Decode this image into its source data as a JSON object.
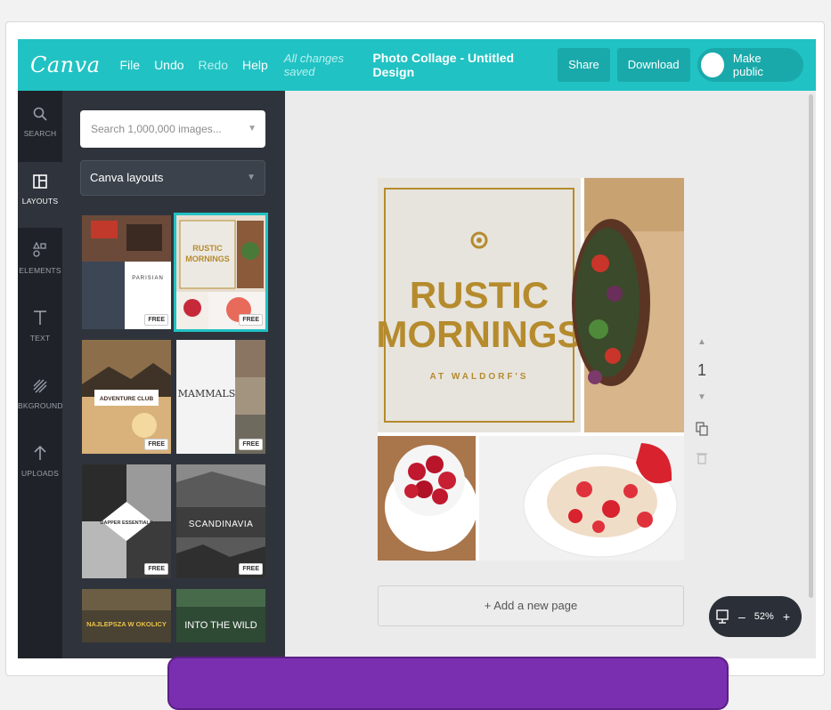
{
  "topbar": {
    "logo": "Canva",
    "menu": {
      "file": "File",
      "undo": "Undo",
      "redo": "Redo",
      "help": "Help"
    },
    "status": "All changes saved",
    "doc_title": "Photo Collage - Untitled Design",
    "share": "Share",
    "download": "Download",
    "make_public": "Make public"
  },
  "rail": [
    {
      "label": "SEARCH",
      "icon": "search-icon"
    },
    {
      "label": "LAYOUTS",
      "icon": "layouts-icon"
    },
    {
      "label": "ELEMENTS",
      "icon": "elements-icon"
    },
    {
      "label": "TEXT",
      "icon": "text-icon"
    },
    {
      "label": "BKGROUND",
      "icon": "background-icon"
    },
    {
      "label": "UPLOADS",
      "icon": "upload-icon"
    }
  ],
  "panel": {
    "search_placeholder": "Search 1,000,000 images...",
    "select_value": "Canva layouts",
    "badge": "FREE",
    "layouts": [
      {
        "lines": [
          "PARISIAN"
        ]
      },
      {
        "lines": [
          "RUSTIC",
          "MORNINGS"
        ]
      },
      {
        "lines": [
          "ADVENTURE CLUB"
        ]
      },
      {
        "lines": [
          "MAMMALS"
        ]
      },
      {
        "lines": [
          "DAPPER ESSENTIALS"
        ]
      },
      {
        "lines": [
          "SCANDINAVIA"
        ]
      },
      {
        "lines": [
          "NAJLEPSZA W OKOLICY"
        ]
      },
      {
        "lines": [
          "INTO THE WILD"
        ]
      }
    ]
  },
  "design": {
    "title_line1": "RUSTIC",
    "title_line2": "MORNINGS",
    "subtitle": "AT WALDORF'S",
    "gold": "#b58b2d"
  },
  "canvas": {
    "page_number": "1",
    "add_page": "+ Add a new page",
    "zoom": "52%"
  }
}
